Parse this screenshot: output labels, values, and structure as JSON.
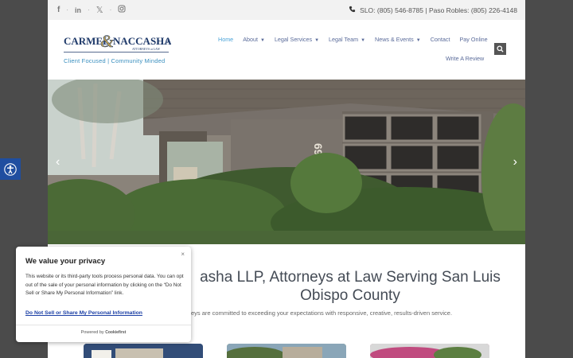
{
  "topbar": {
    "social_icons": [
      "facebook-icon",
      "linkedin-icon",
      "x-icon",
      "instagram-icon"
    ],
    "phone_text": "SLO: (805) 546-8785 | Paso Robles: (805) 226-4148"
  },
  "header": {
    "tagline": "Client Focused | Community Minded",
    "nav": [
      "Home",
      "About",
      "Legal Services",
      "Legal Team",
      "News & Events",
      "Contact",
      "Pay Online"
    ],
    "review": "Write A Review"
  },
  "logo": {
    "name_left": "CARMEL",
    "ampersand": "&",
    "name_right": "NACCASHA",
    "llp": "LLP",
    "attorneys": "ATTORNEYS at LAW"
  },
  "hero": {
    "house_number": "694"
  },
  "content": {
    "headline": "asha LLP, Attorneys at Law Serving San Luis Obispo County",
    "subline": "eys are committed to exceeding your expectations with responsive, creative, results-driven service."
  },
  "cookie": {
    "title": "We value your privacy",
    "body": "This website or its third-party tools process personal data. You can opt out of the sale of your personal information by clicking on the “Do Not Sell or Share My Personal Information” link.",
    "link": "Do Not Sell or Share My Personal Information",
    "powered_by": "Powered by",
    "brand": "Cookiefirst",
    "close": "×"
  },
  "colors": {
    "accent": "#4aa3d8",
    "nav": "#5a6b9a",
    "access": "#1f4ea0"
  }
}
